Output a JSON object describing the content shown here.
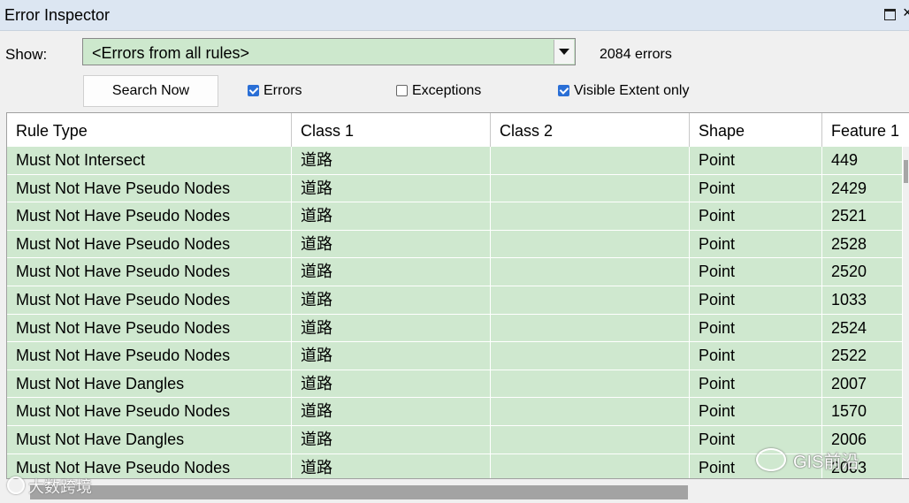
{
  "window": {
    "title": "Error Inspector",
    "restore_icon": "restore-icon",
    "close_icon": "close-icon",
    "close_glyph": "×"
  },
  "controls": {
    "show_label": "Show:",
    "show_selected": "<Errors from all rules>",
    "error_count": "2084 errors",
    "search_button": "Search Now",
    "errors_label": "Errors",
    "errors_checked": true,
    "exceptions_label": "Exceptions",
    "exceptions_checked": false,
    "visible_extent_label": "Visible Extent only",
    "visible_extent_checked": true
  },
  "table": {
    "columns": [
      "Rule Type",
      "Class 1",
      "Class 2",
      "Shape",
      "Feature 1"
    ],
    "rows": [
      {
        "rule_type": "Must Not Intersect",
        "class1": "道路",
        "class2": "",
        "shape": "Point",
        "feature1": "449"
      },
      {
        "rule_type": "Must Not Have Pseudo Nodes",
        "class1": "道路",
        "class2": "",
        "shape": "Point",
        "feature1": "2429"
      },
      {
        "rule_type": "Must Not Have Pseudo Nodes",
        "class1": "道路",
        "class2": "",
        "shape": "Point",
        "feature1": "2521"
      },
      {
        "rule_type": "Must Not Have Pseudo Nodes",
        "class1": "道路",
        "class2": "",
        "shape": "Point",
        "feature1": "2528"
      },
      {
        "rule_type": "Must Not Have Pseudo Nodes",
        "class1": "道路",
        "class2": "",
        "shape": "Point",
        "feature1": "2520"
      },
      {
        "rule_type": "Must Not Have Pseudo Nodes",
        "class1": "道路",
        "class2": "",
        "shape": "Point",
        "feature1": "1033"
      },
      {
        "rule_type": "Must Not Have Pseudo Nodes",
        "class1": "道路",
        "class2": "",
        "shape": "Point",
        "feature1": "2524"
      },
      {
        "rule_type": "Must Not Have Pseudo Nodes",
        "class1": "道路",
        "class2": "",
        "shape": "Point",
        "feature1": "2522"
      },
      {
        "rule_type": "Must Not Have Dangles",
        "class1": "道路",
        "class2": "",
        "shape": "Point",
        "feature1": "2007"
      },
      {
        "rule_type": "Must Not Have Pseudo Nodes",
        "class1": "道路",
        "class2": "",
        "shape": "Point",
        "feature1": "1570"
      },
      {
        "rule_type": "Must Not Have Dangles",
        "class1": "道路",
        "class2": "",
        "shape": "Point",
        "feature1": "2006"
      },
      {
        "rule_type": "Must Not Have Pseudo Nodes",
        "class1": "道路",
        "class2": "",
        "shape": "Point",
        "feature1": "2003"
      }
    ]
  },
  "watermarks": {
    "left": "大数跨境",
    "right": "GIS前沿"
  },
  "colors": {
    "row_background": "#cfe8cf",
    "checkbox_checked": "#2a6fd6",
    "title_bar": "#dce6f2"
  }
}
